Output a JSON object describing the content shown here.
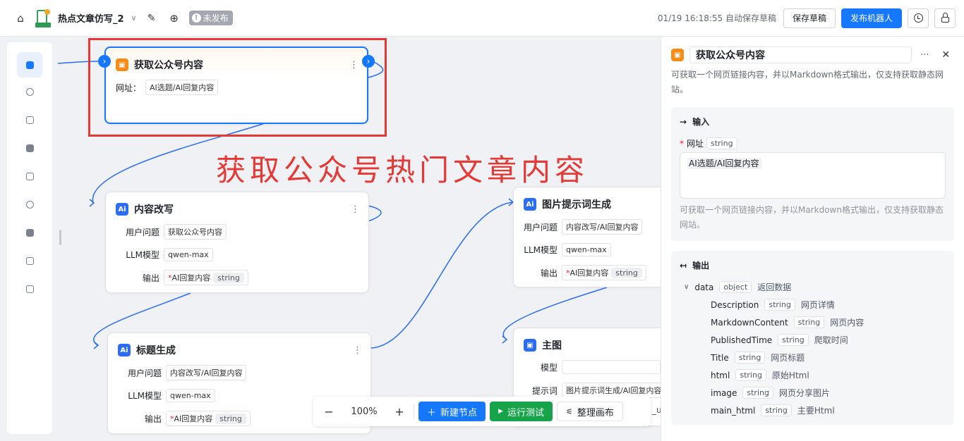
{
  "topbar": {
    "app_title": "热点文章仿写_2",
    "status": "未发布",
    "autosave": "01/19 16:18:55 自动保存草稿",
    "save_draft": "保存草稿",
    "publish": "发布机器人"
  },
  "annotation": "获取公众号热门文章内容",
  "nodes": {
    "fetch": {
      "title": "获取公众号内容",
      "url_label": "网址：",
      "url_value": "AI选题/AI回复内容"
    },
    "rewrite": {
      "title": "内容改写",
      "rows": [
        {
          "label": "用户问题",
          "value": "获取公众号内容"
        },
        {
          "label": "LLM模型",
          "value": "qwen-max"
        }
      ],
      "output_label": "输出",
      "output_value": "AI回复内容",
      "output_type": "string"
    },
    "headline": {
      "title": "标题生成",
      "rows": [
        {
          "label": "用户问题",
          "value": "内容改写/AI回复内容"
        },
        {
          "label": "LLM模型",
          "value": "qwen-max"
        }
      ],
      "output_label": "输出",
      "output_value": "AI回复内容",
      "output_type": "string"
    },
    "imgprompt": {
      "title": "图片提示词生成",
      "rows": [
        {
          "label": "用户问题",
          "value": "内容改写/AI回复内容"
        },
        {
          "label": "LLM模型",
          "value": "qwen-max"
        }
      ],
      "output_label": "输出",
      "output_value": "AI回复内容",
      "output_type": "string"
    },
    "mainimg": {
      "title": "主图",
      "rows": [
        {
          "label": "模型",
          "value": ""
        },
        {
          "label": "提示词",
          "value": "图片提示词生成/AI回复内容"
        }
      ],
      "partial": "_u"
    }
  },
  "bottombar": {
    "zoom": "100%",
    "new_node": "新建节点",
    "run_test": "运行测试",
    "arrange": "整理画布"
  },
  "panel": {
    "title": "获取公众号内容",
    "desc": "可获取一个网页链接内容，并以Markdown格式输出，仅支持获取静态网站。",
    "input": {
      "heading": "输入",
      "field_label": "网址",
      "field_type": "string",
      "field_value": "AI选题/AI回复内容",
      "hint": "可获取一个网页链接内容，并以Markdown格式输出，仅支持获取静态网站。"
    },
    "output": {
      "heading": "输出",
      "root": {
        "name": "data",
        "type": "object",
        "desc": "返回数据"
      },
      "fields": [
        {
          "name": "Description",
          "type": "string",
          "desc": "网页详情"
        },
        {
          "name": "MarkdownContent",
          "type": "string",
          "desc": "网页内容"
        },
        {
          "name": "PublishedTime",
          "type": "string",
          "desc": "爬取时间"
        },
        {
          "name": "Title",
          "type": "string",
          "desc": "网页标题"
        },
        {
          "name": "html",
          "type": "string",
          "desc": "原始Html"
        },
        {
          "name": "image",
          "type": "string",
          "desc": "网页分享图片"
        },
        {
          "name": "main_html",
          "type": "string",
          "desc": "主要Html"
        }
      ]
    }
  },
  "colors": {
    "accent": "#1677ff",
    "annotation_red": "#e53935",
    "run_green": "#16a34a",
    "node_orange": "#fa8c16"
  }
}
